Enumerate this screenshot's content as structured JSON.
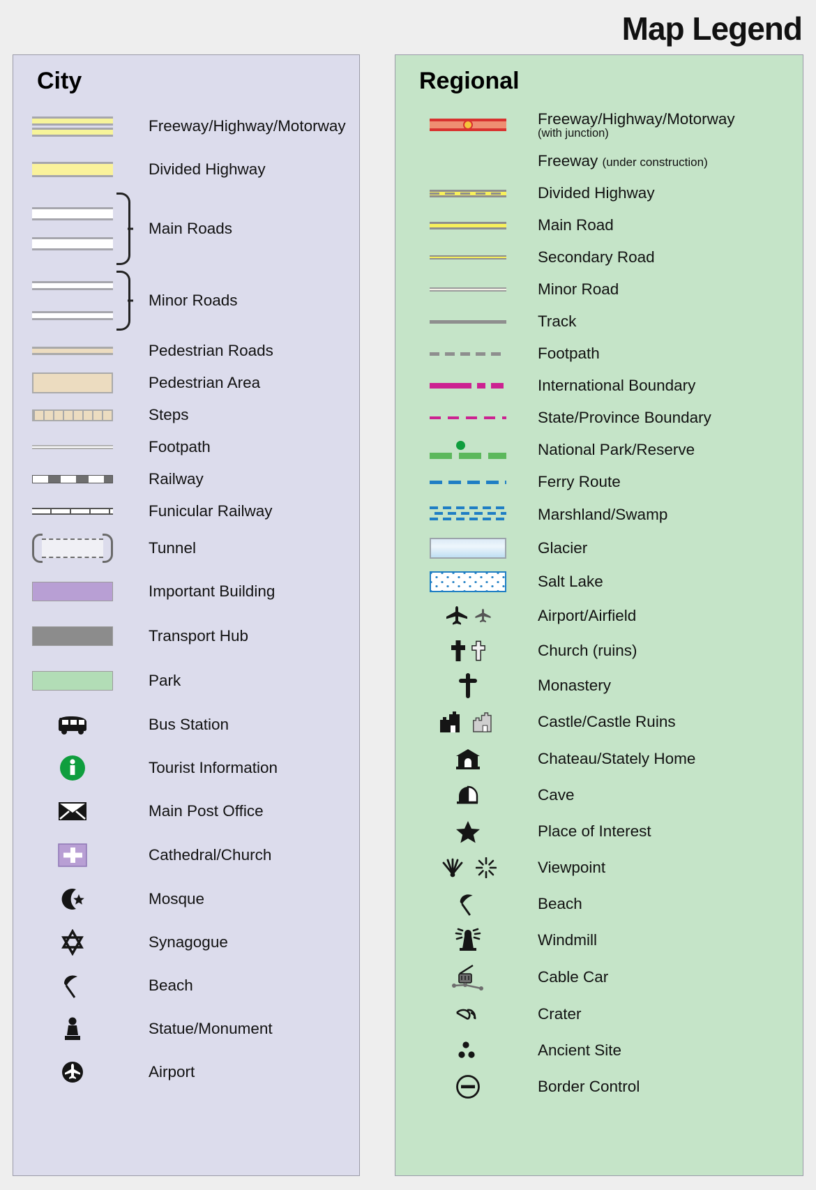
{
  "title": "Map Legend",
  "city": {
    "heading": "City",
    "background": "#dcdcec",
    "items": [
      {
        "label": "Freeway/Highway/Motorway",
        "symbol": "freeway-dual-band"
      },
      {
        "label": "Divided Highway",
        "symbol": "divided-highway-band"
      },
      {
        "label": "Main Roads",
        "symbol": "white-road-pair-braced"
      },
      {
        "label": "Minor Roads",
        "symbol": "thin-white-road-pair-braced"
      },
      {
        "label": "Pedestrian Roads",
        "symbol": "tan-road-band"
      },
      {
        "label": "Pedestrian Area",
        "symbol": "tan-filled-area"
      },
      {
        "label": "Steps",
        "symbol": "tan-stepped-band"
      },
      {
        "label": "Footpath",
        "symbol": "thin-white-line"
      },
      {
        "label": "Railway",
        "symbol": "dashed-block-rail"
      },
      {
        "label": "Funicular Railway",
        "symbol": "ticked-rail-line"
      },
      {
        "label": "Tunnel",
        "symbol": "bracketed-dashed-tunnel"
      },
      {
        "label": "Important Building",
        "symbol": "purple-fill-block"
      },
      {
        "label": "Transport Hub",
        "symbol": "grey-fill-block"
      },
      {
        "label": "Park",
        "symbol": "green-fill-block"
      },
      {
        "label": "Bus Station",
        "symbol": "bus-icon"
      },
      {
        "label": "Tourist Information",
        "symbol": "information-icon"
      },
      {
        "label": "Main Post Office",
        "symbol": "envelope-icon"
      },
      {
        "label": "Cathedral/Church",
        "symbol": "cross-on-purple-square-icon"
      },
      {
        "label": "Mosque",
        "symbol": "crescent-star-icon"
      },
      {
        "label": "Synagogue",
        "symbol": "star-of-david-icon"
      },
      {
        "label": "Beach",
        "symbol": "beach-umbrella-icon"
      },
      {
        "label": "Statue/Monument",
        "symbol": "statue-icon"
      },
      {
        "label": "Airport",
        "symbol": "airplane-circle-icon"
      }
    ]
  },
  "regional": {
    "heading": "Regional",
    "background": "#c5e4c8",
    "items": [
      {
        "label": "Freeway/Highway/Motorway",
        "sublabel": "(with junction)",
        "sub_block": true,
        "symbol": "freeway-junction-line"
      },
      {
        "label": "Freeway",
        "sublabel": "(under construction)",
        "symbol": "dashed-freeway-line"
      },
      {
        "label": "Divided Highway",
        "symbol": "yellow-dashed-centre-line"
      },
      {
        "label": "Main Road",
        "symbol": "yellow-thick-line"
      },
      {
        "label": "Secondary Road",
        "symbol": "yellow-thin-line"
      },
      {
        "label": "Minor Road",
        "symbol": "cream-thin-line"
      },
      {
        "label": "Track",
        "symbol": "grey-solid-line"
      },
      {
        "label": "Footpath",
        "symbol": "grey-dashed-line"
      },
      {
        "label": "International Boundary",
        "symbol": "magenta-dash-dot-line"
      },
      {
        "label": "State/Province Boundary",
        "symbol": "magenta-thin-dashed-line"
      },
      {
        "label": "National Park/Reserve",
        "symbol": "green-dash-dot-line"
      },
      {
        "label": "Ferry Route",
        "symbol": "blue-dashed-line"
      },
      {
        "label": "Marshland/Swamp",
        "symbol": "marsh-hatch-pattern"
      },
      {
        "label": "Glacier",
        "symbol": "blue-gradient-block"
      },
      {
        "label": "Salt Lake",
        "symbol": "dotted-white-block"
      },
      {
        "label": "Airport/Airfield",
        "symbol": "airplane-pair-icon"
      },
      {
        "label": "Church (ruins)",
        "symbol": "cross-pair-icon"
      },
      {
        "label": "Monastery",
        "symbol": "orthodox-cross-icon"
      },
      {
        "label": "Castle/Castle Ruins",
        "symbol": "castle-pair-icon"
      },
      {
        "label": "Chateau/Stately Home",
        "symbol": "chateau-icon"
      },
      {
        "label": "Cave",
        "symbol": "cave-icon"
      },
      {
        "label": "Place of Interest",
        "symbol": "star-icon"
      },
      {
        "label": "Viewpoint",
        "symbol": "viewpoint-pair-icon"
      },
      {
        "label": "Beach",
        "symbol": "beach-umbrella-icon"
      },
      {
        "label": "Windmill",
        "symbol": "windmill-icon"
      },
      {
        "label": "Cable Car",
        "symbol": "cable-car-icon"
      },
      {
        "label": "Crater",
        "symbol": "crater-icon"
      },
      {
        "label": "Ancient Site",
        "symbol": "three-dots-icon"
      },
      {
        "label": "Border Control",
        "symbol": "minus-circle-icon"
      }
    ]
  },
  "colors": {
    "city_panel": "#dcdcec",
    "regional_panel": "#c5e4c8",
    "page_background": "#eeeeee",
    "highway_yellow": "#f7f05c",
    "freeway_red": "#d8322f",
    "junction_orange": "#f5c33c",
    "boundary_magenta": "#cc2291",
    "park_green": "#5cb85c",
    "ferry_blue": "#1f7ec4",
    "building_purple": "#b89fd4",
    "pedestrian_tan": "#ecdcc0",
    "info_green": "#0f9e3e"
  }
}
